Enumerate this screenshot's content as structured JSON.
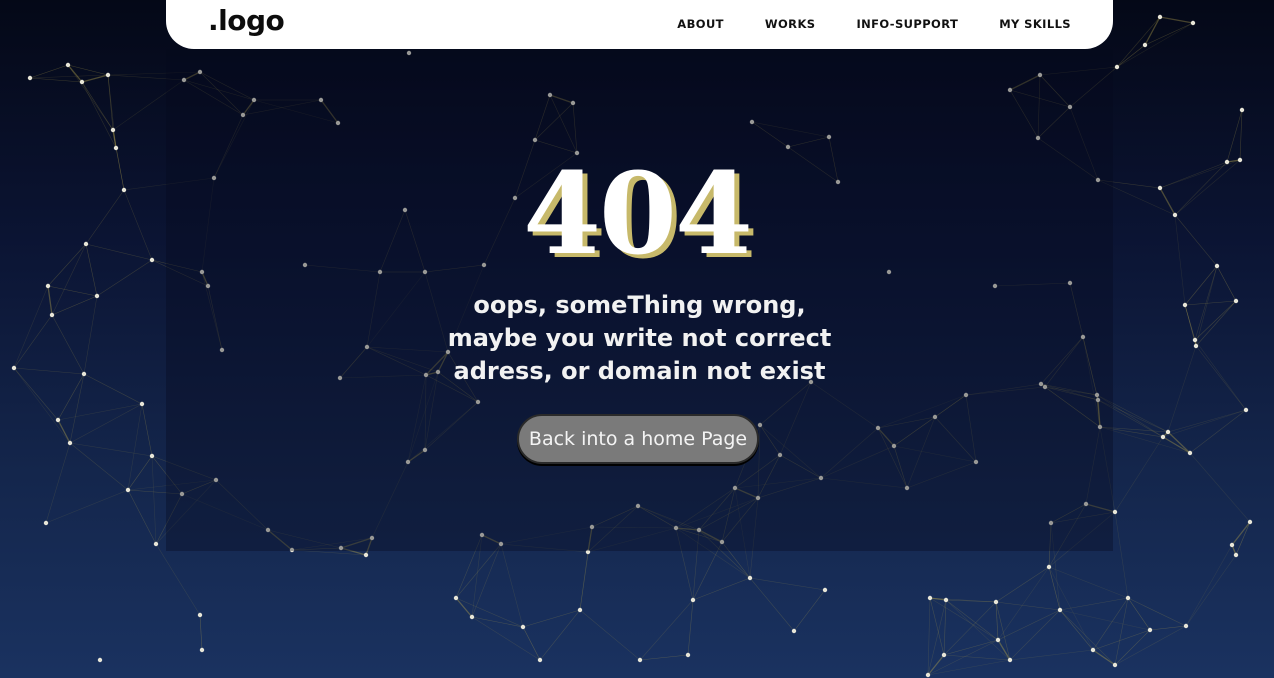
{
  "nav": {
    "logo": ".logo",
    "links": [
      "ABOUT",
      "WORKS",
      "INFO-SUPPORT",
      "MY SKILLS"
    ]
  },
  "error": {
    "code": "404",
    "message": "oops, someThing wrong, maybe you write not correct adress, or domain not exist",
    "button_label": "Back into a home Page"
  },
  "colors": {
    "background_top": "#040817",
    "background_bottom": "#1a3260",
    "navbar_bg": "#ffffff",
    "code_shadow": "#c7b96a",
    "button_bg": "#7a7a7a",
    "network_line": "#a99b4a",
    "network_dot": "#e8e6d8"
  }
}
